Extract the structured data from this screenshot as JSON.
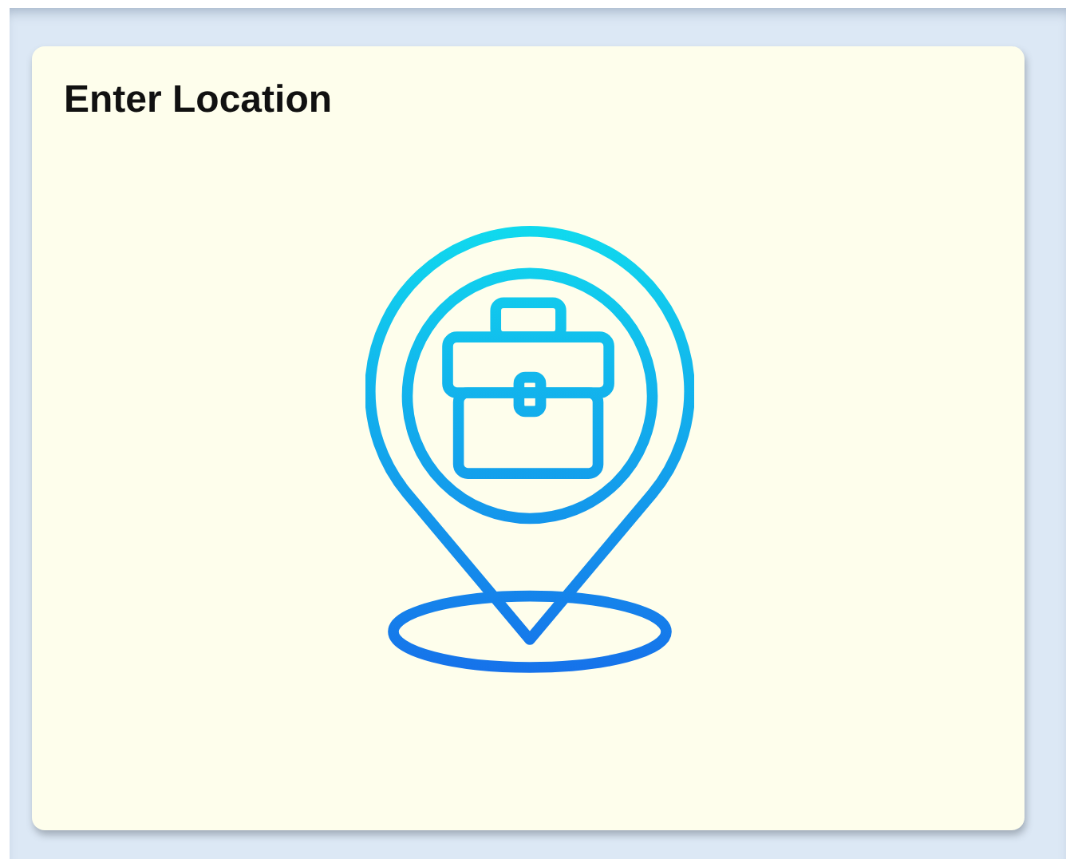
{
  "tile": {
    "title": "Enter Location"
  }
}
